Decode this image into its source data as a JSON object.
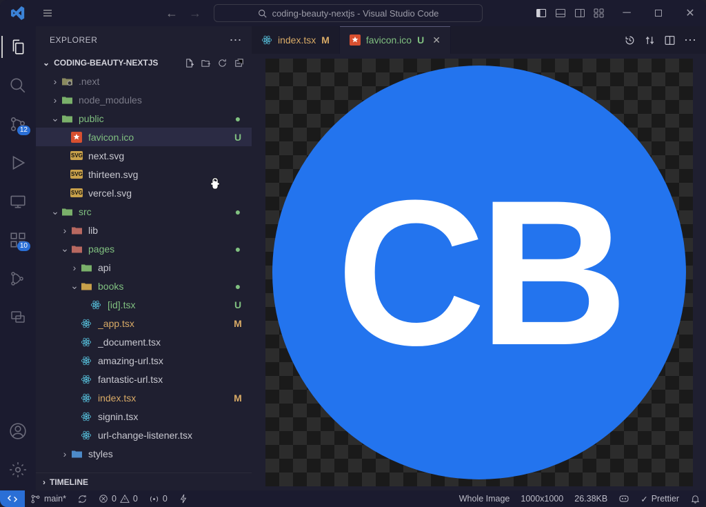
{
  "title": "coding-beauty-nextjs - Visual Studio Code",
  "explorer": {
    "title": "EXPLORER",
    "project": "CODING-BEAUTY-NEXTJS",
    "timeline": "TIMELINE"
  },
  "tree": [
    {
      "indent": 1,
      "twisty": ">",
      "iconType": "folder-gray",
      "label": ".next",
      "cls": "dim"
    },
    {
      "indent": 1,
      "twisty": ">",
      "iconType": "folder-green",
      "label": "node_modules",
      "cls": "dim"
    },
    {
      "indent": 1,
      "twisty": "v",
      "iconType": "folder-green",
      "label": "public",
      "cls": "green",
      "dot": true
    },
    {
      "indent": 2,
      "twisty": "",
      "iconType": "favicon",
      "label": "favicon.ico",
      "cls": "green active",
      "status": "U"
    },
    {
      "indent": 2,
      "twisty": "",
      "iconType": "svg",
      "label": "next.svg"
    },
    {
      "indent": 2,
      "twisty": "",
      "iconType": "svg",
      "label": "thirteen.svg"
    },
    {
      "indent": 2,
      "twisty": "",
      "iconType": "svg",
      "label": "vercel.svg"
    },
    {
      "indent": 1,
      "twisty": "v",
      "iconType": "folder-green",
      "label": "src",
      "cls": "green",
      "dot": true
    },
    {
      "indent": 2,
      "twisty": ">",
      "iconType": "folder-red",
      "label": "lib"
    },
    {
      "indent": 2,
      "twisty": "v",
      "iconType": "folder-red",
      "label": "pages",
      "cls": "green",
      "dot": true
    },
    {
      "indent": 3,
      "twisty": ">",
      "iconType": "folder-green",
      "label": "api"
    },
    {
      "indent": 3,
      "twisty": "v",
      "iconType": "folder-yellow",
      "label": "books",
      "cls": "green",
      "dot": true
    },
    {
      "indent": 4,
      "twisty": "",
      "iconType": "react",
      "label": "[id].tsx",
      "cls": "green",
      "status": "U"
    },
    {
      "indent": 3,
      "twisty": "",
      "iconType": "react",
      "label": "_app.tsx",
      "cls": "orange",
      "status": "M"
    },
    {
      "indent": 3,
      "twisty": "",
      "iconType": "react",
      "label": "_document.tsx"
    },
    {
      "indent": 3,
      "twisty": "",
      "iconType": "react",
      "label": "amazing-url.tsx"
    },
    {
      "indent": 3,
      "twisty": "",
      "iconType": "react",
      "label": "fantastic-url.tsx"
    },
    {
      "indent": 3,
      "twisty": "",
      "iconType": "react",
      "label": "index.tsx",
      "cls": "orange",
      "status": "M"
    },
    {
      "indent": 3,
      "twisty": "",
      "iconType": "react",
      "label": "signin.tsx"
    },
    {
      "indent": 3,
      "twisty": "",
      "iconType": "react",
      "label": "url-change-listener.tsx"
    },
    {
      "indent": 2,
      "twisty": ">",
      "iconType": "folder-blue",
      "label": "styles"
    }
  ],
  "tabs": [
    {
      "icon": "react",
      "name": "index.tsx",
      "status": "M",
      "cls": "orange"
    },
    {
      "icon": "favicon",
      "name": "favicon.ico",
      "status": "U",
      "cls": "green active",
      "close": true
    }
  ],
  "activity_badges": {
    "scm": "12",
    "ext": "10"
  },
  "statusbar": {
    "branch": "main*",
    "errors": "0",
    "warnings": "0",
    "ports": "0",
    "zoom": "Whole Image",
    "dims": "1000x1000",
    "size": "26.38KB",
    "prettier": "Prettier"
  },
  "favicon_text": "CB"
}
